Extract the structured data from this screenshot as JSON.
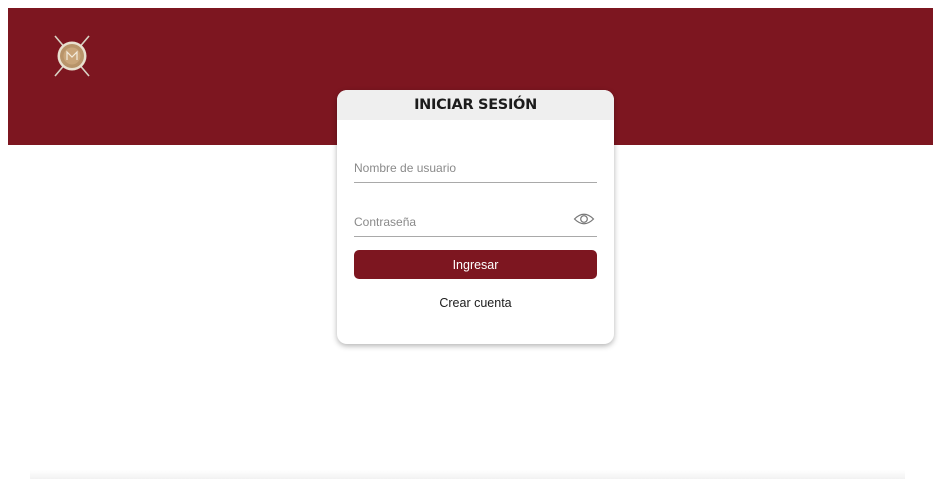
{
  "header": {
    "logo_icon": "crossed-drum-logo-icon",
    "banner_color": "#7d1620"
  },
  "login": {
    "title": "INICIAR SESIÓN",
    "username": {
      "value": "",
      "placeholder": "Nombre de usuario"
    },
    "password": {
      "value": "",
      "placeholder": "Contraseña",
      "toggle_icon": "eye-icon"
    },
    "submit_label": "Ingresar",
    "create_account_label": "Crear cuenta",
    "accent_color": "#7d1620"
  }
}
